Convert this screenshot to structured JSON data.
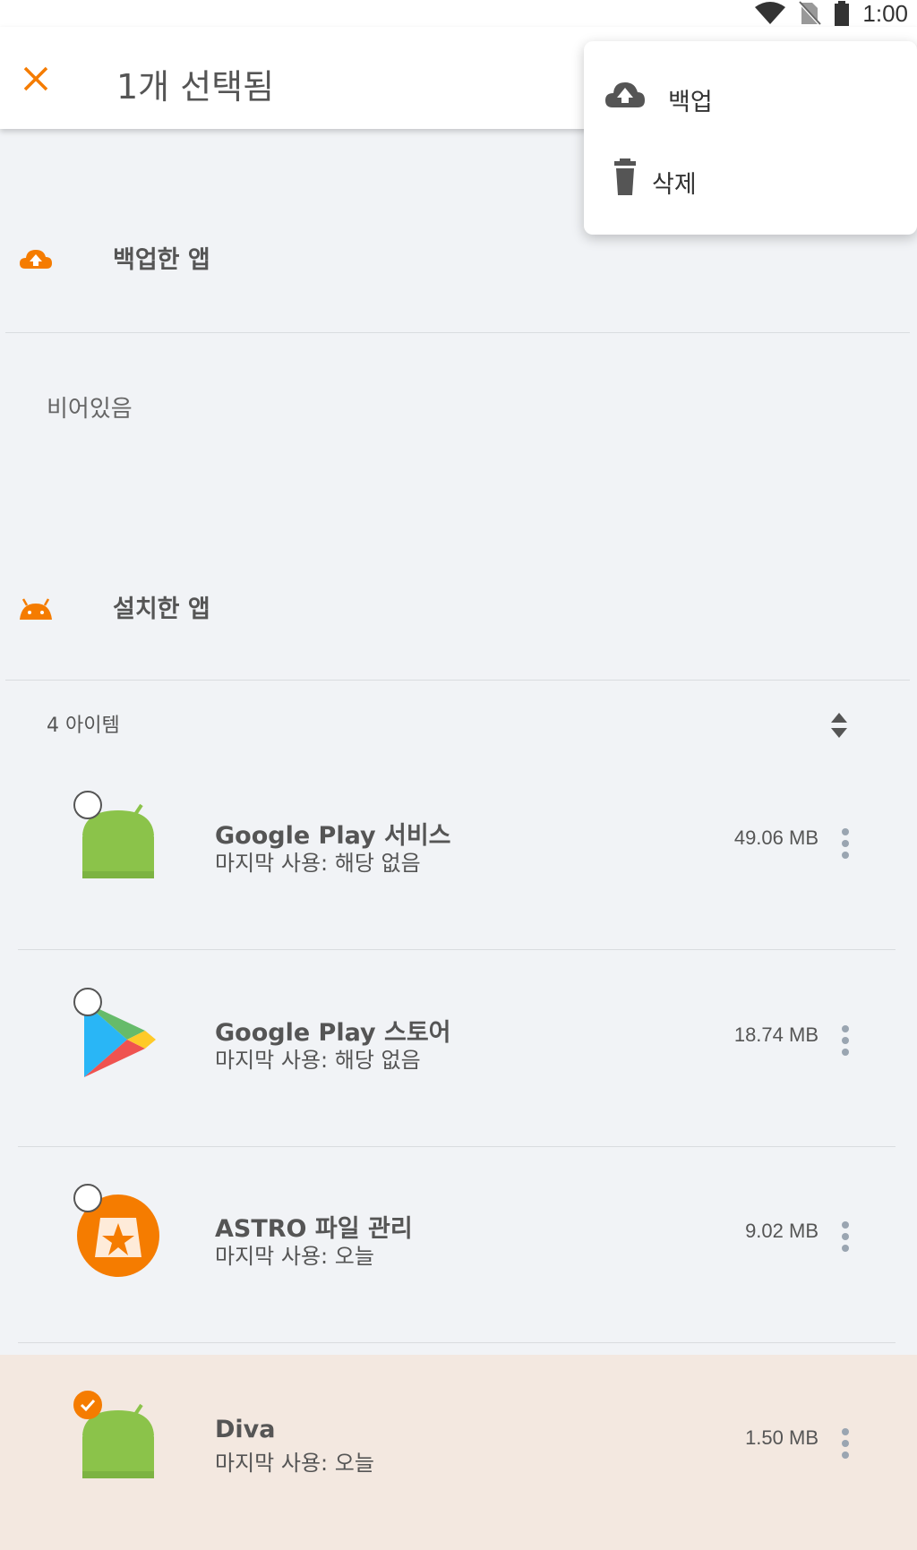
{
  "status": {
    "time": "1:00"
  },
  "appbar": {
    "title": "1개 선택됨"
  },
  "menu": {
    "items": [
      {
        "label": "백업",
        "icon": "cloud-upload-icon"
      },
      {
        "label": "삭제",
        "icon": "trash-icon"
      }
    ]
  },
  "backed_up": {
    "header": "백업한 앱",
    "empty": "비어있음"
  },
  "installed": {
    "header": "설치한 앱",
    "count": "4 아이템"
  },
  "apps": [
    {
      "name": "Google Play 서비스",
      "last_used": "마지막 사용: 해당 없음",
      "size": "49.06 MB",
      "checked": false
    },
    {
      "name": "Google Play 스토어",
      "last_used": "마지막 사용: 해당 없음",
      "size": "18.74 MB",
      "checked": false
    },
    {
      "name": "ASTRO 파일 관리",
      "last_used": "마지막 사용: 오늘",
      "size": "9.02 MB",
      "checked": false
    },
    {
      "name": "Diva",
      "last_used": "마지막 사용: 오늘",
      "size": "1.50 MB",
      "checked": true
    }
  ],
  "colors": {
    "accent": "#f57c00",
    "selected_row": "#f3e8e0",
    "background": "#f1f3f6"
  }
}
